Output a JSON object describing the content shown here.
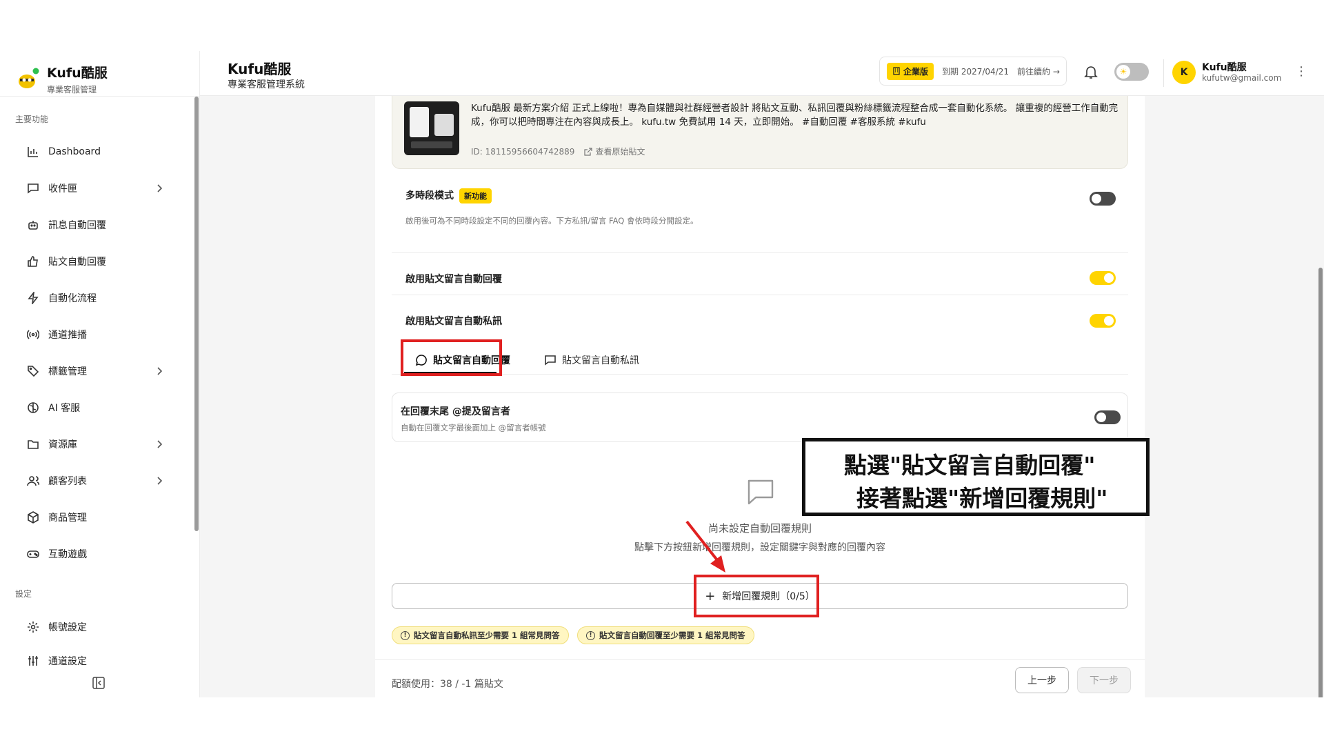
{
  "brand": {
    "name": "Kufu酷服",
    "subtitle": "專業客服管理"
  },
  "header": {
    "title": "Kufu酷服",
    "subtitle": "專業客服管理系統",
    "plan_badge": "企業版",
    "plan_expiry": "到期 2027/04/21",
    "plan_link": "前往續約 →",
    "user_initial": "K",
    "user_name": "Kufu酷服",
    "user_email": "kufutw@gmail.com"
  },
  "sidebar": {
    "section_main": "主要功能",
    "section_settings": "設定",
    "items": [
      {
        "label": "Dashboard",
        "icon": "bar-chart-icon",
        "has_chevron": false
      },
      {
        "label": "收件匣",
        "icon": "message-square-icon",
        "has_chevron": true
      },
      {
        "label": "訊息自動回覆",
        "icon": "bot-icon",
        "has_chevron": false
      },
      {
        "label": "貼文自動回覆",
        "icon": "thumbs-up-icon",
        "has_chevron": false
      },
      {
        "label": "自動化流程",
        "icon": "lightning-icon",
        "has_chevron": false
      },
      {
        "label": "通道推播",
        "icon": "broadcast-icon",
        "has_chevron": false
      },
      {
        "label": "標籤管理",
        "icon": "tags-icon",
        "has_chevron": true
      },
      {
        "label": "AI 客服",
        "icon": "brain-icon",
        "has_chevron": false
      },
      {
        "label": "資源庫",
        "icon": "folder-icon",
        "has_chevron": true
      },
      {
        "label": "顧客列表",
        "icon": "users-icon",
        "has_chevron": true
      },
      {
        "label": "商品管理",
        "icon": "package-icon",
        "has_chevron": false
      },
      {
        "label": "互動遊戲",
        "icon": "gamepad-icon",
        "has_chevron": false
      }
    ],
    "settings_items": [
      {
        "label": "帳號設定",
        "icon": "gear-icon"
      },
      {
        "label": "通道設定",
        "icon": "sliders-icon"
      }
    ]
  },
  "post": {
    "text": "Kufu酷服 最新方案介紹 正式上線啦！專為自媒體與社群經營者設計 將貼文互動、私訊回覆與粉絲標籤流程整合成一套自動化系統。 讓重複的經營工作自動完成，你可以把時間專注在內容與成長上。 kufu.tw 免費試用 14 天，立即開始。 #自動回覆 #客服系統 #kufu",
    "id": "ID: 18115956604742889",
    "view_link": "查看原始貼文"
  },
  "multi_period": {
    "title": "多時段模式",
    "badge": "新功能",
    "desc": "啟用後可為不同時段設定不同的回覆內容。下方私訊/留言 FAQ 會依時段分開設定。",
    "enabled": false
  },
  "comment_reply": {
    "title": "啟用貼文留言自動回覆",
    "enabled": true
  },
  "comment_dm": {
    "title": "啟用貼文留言自動私訊",
    "enabled": true
  },
  "tabs": [
    {
      "label": "貼文留言自動回覆",
      "active": true
    },
    {
      "label": "貼文留言自動私訊",
      "active": false
    }
  ],
  "mention": {
    "title": "在回覆末尾 @提及留言者",
    "desc": "自動在回覆文字最後面加上 @留言者帳號",
    "enabled": false
  },
  "empty_state": {
    "title": "尚未設定自動回覆規則",
    "desc": "點擊下方按鈕新增回覆規則，設定關鍵字與對應的回覆內容"
  },
  "add_rule_button": "新增回覆規則（0/5）",
  "warnings": [
    "貼文留言自動私訊至少需要 1 組常見問答",
    "貼文留言自動回覆至少需要 1 組常見問答"
  ],
  "footer": {
    "quota": "配額使用：38 / -1 篇貼文",
    "prev": "上一步",
    "next": "下一步"
  },
  "annotation": {
    "line1": "點選\"貼文留言自動回覆\"",
    "line2": "接著點選\"新增回覆規則\""
  },
  "colors": {
    "accent": "#ffd400",
    "highlight_red": "#e02020"
  }
}
